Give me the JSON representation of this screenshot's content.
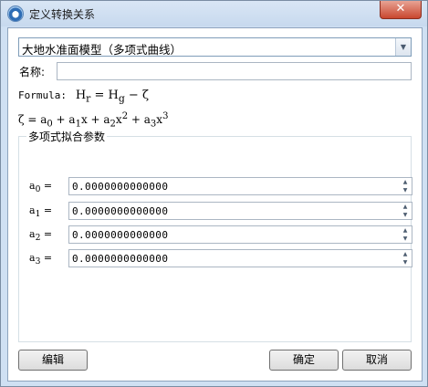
{
  "window": {
    "title": "定义转换关系",
    "close_label": "✕"
  },
  "model_select": {
    "value": "大地水准面模型（多项式曲线）",
    "arrow": "▼"
  },
  "name_field": {
    "label": "名称:",
    "value": ""
  },
  "formula": {
    "label": "Formula:",
    "expr_html": "H<sub>r</sub> = H<sub>g</sub> − ζ",
    "poly_html": "ζ = a<sub>0</sub> + a<sub>1</sub>x + a<sub>2</sub>x<sup>2</sup> + a<sub>3</sub>x<sup>3</sup>"
  },
  "params": {
    "group_title": "多项式拟合参数",
    "rows": [
      {
        "label_html": "a<sub>0</sub> =",
        "value": "0.0000000000000"
      },
      {
        "label_html": "a<sub>1</sub> =",
        "value": "0.0000000000000"
      },
      {
        "label_html": "a<sub>2</sub> =",
        "value": "0.0000000000000"
      },
      {
        "label_html": "a<sub>3</sub> =",
        "value": "0.0000000000000"
      }
    ],
    "spin_up": "▲",
    "spin_down": "▼"
  },
  "buttons": {
    "edit": "编辑",
    "ok": "确定",
    "cancel": "取消"
  }
}
